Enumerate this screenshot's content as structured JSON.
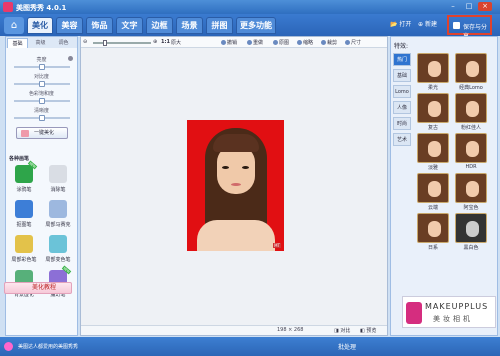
{
  "window": {
    "title": "美图秀秀 4.0.1"
  },
  "menu": {
    "tabs": [
      "美化",
      "美容",
      "饰品",
      "文字",
      "边框",
      "场景",
      "拼图",
      "更多功能"
    ],
    "open_label": "打开",
    "new_label": "新建",
    "save_label": "保存与分享"
  },
  "left_panel": {
    "tabs": [
      "基础",
      "高级",
      "调色"
    ],
    "sliders": [
      {
        "label": "亮度",
        "value": 0.5
      },
      {
        "label": "对比度",
        "value": 0.5
      },
      {
        "label": "色彩饱和度",
        "value": 0.5
      },
      {
        "label": "清晰度",
        "value": 0.5
      }
    ],
    "one_click_label": "一键美化",
    "brushes_title": "各种画笔",
    "brushes": [
      {
        "label": "涂鸦笔",
        "color": "#2ea54a",
        "new": true
      },
      {
        "label": "消除笔",
        "color": "#d9dde4",
        "new": false
      },
      {
        "label": "抠图笔",
        "color": "#3d7ed7",
        "new": false
      },
      {
        "label": "局部马赛克",
        "color": "#9db8df",
        "new": false
      },
      {
        "label": "局部彩色笔",
        "color": "#e3c24a",
        "new": false
      },
      {
        "label": "局部变色笔",
        "color": "#6bc3d8",
        "new": false
      },
      {
        "label": "背景虚化",
        "color": "#57b07a",
        "new": false
      },
      {
        "label": "魔幻笔",
        "color": "#8c6fd6",
        "new": true
      }
    ],
    "meirong_label": "美化教程"
  },
  "center": {
    "toolbar": [
      "原大",
      "撤销",
      "重做",
      "原图",
      "缩略",
      "裁剪",
      "尺寸"
    ],
    "zoom_label": "1:1",
    "image_size": "198 × 268",
    "compare_label": "对比",
    "preview_label": "预览"
  },
  "right_panel": {
    "title": "特效:",
    "categories": [
      "热门",
      "基础",
      "Lomo",
      "人像",
      "时尚",
      "艺术"
    ],
    "effects": [
      "柔光",
      "经典Lomo",
      "复古",
      "粉红佳人",
      "淡雅",
      "HDR",
      "云端",
      "阿宝色",
      "日系",
      "黑白色"
    ],
    "ad_line1": "MAKEUPPLUS",
    "ad_line2": "美妆相机"
  },
  "status": {
    "message": "美图达人都爱用的美图秀秀",
    "batch_label": "批处理"
  }
}
